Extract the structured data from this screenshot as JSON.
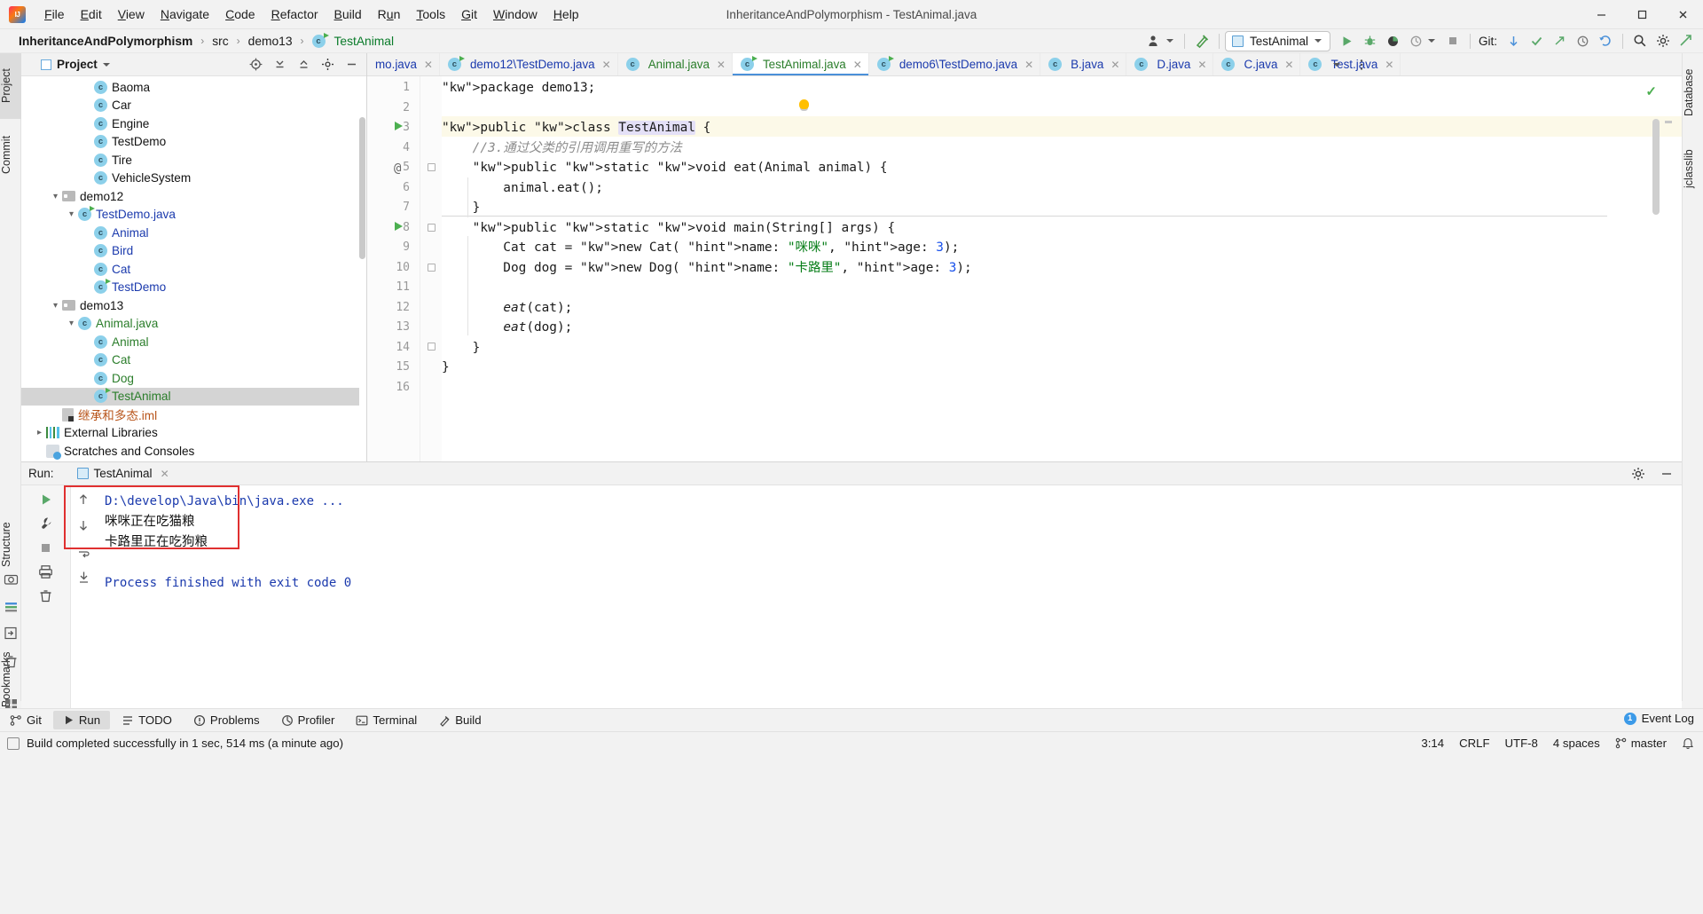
{
  "window": {
    "title": "InheritanceAndPolymorphism - TestAnimal.java",
    "minimize": "—",
    "maximize": "❐",
    "close": "✕"
  },
  "menu": [
    "File",
    "Edit",
    "View",
    "Navigate",
    "Code",
    "Refactor",
    "Build",
    "Run",
    "Tools",
    "Git",
    "Window",
    "Help"
  ],
  "breadcrumb": {
    "project": "InheritanceAndPolymorphism",
    "src": "src",
    "package": "demo13",
    "file": "TestAnimal",
    "separator": "›"
  },
  "toolbar": {
    "run_config": "TestAnimal",
    "git_label": "Git:",
    "run_tooltip": "Run",
    "debug_tooltip": "Debug",
    "coverage_tooltip": "Run with Coverage",
    "profiler_tooltip": "Profiler",
    "stop_tooltip": "Stop",
    "search_tooltip": "Search Everywhere",
    "settings_tooltip": "Settings",
    "updates_tooltip": "Updates"
  },
  "left_strip": {
    "project_tab": "Project",
    "commit_tab": "Commit",
    "structure_tab": "Structure",
    "bookmarks_tab": "Bookmarks"
  },
  "right_strip": {
    "database_tab": "Database",
    "jclasslib_tab": "jclasslib"
  },
  "project_panel": {
    "title": "Project",
    "tree": [
      {
        "label": "Baoma",
        "icon": "class-icon",
        "indent": 4,
        "arrow": "",
        "color": "dark",
        "selected": false
      },
      {
        "label": "Car",
        "icon": "class-icon",
        "indent": 4,
        "arrow": "",
        "color": "dark",
        "selected": false
      },
      {
        "label": "Engine",
        "icon": "class-icon",
        "indent": 4,
        "arrow": "",
        "color": "dark",
        "selected": false
      },
      {
        "label": "TestDemo",
        "icon": "class-icon",
        "indent": 4,
        "arrow": "",
        "color": "dark",
        "selected": false
      },
      {
        "label": "Tire",
        "icon": "class-icon",
        "indent": 4,
        "arrow": "",
        "color": "dark",
        "selected": false
      },
      {
        "label": "VehicleSystem",
        "icon": "class-icon",
        "indent": 4,
        "arrow": "",
        "color": "dark",
        "selected": false
      },
      {
        "label": "demo12",
        "icon": "folder-icon",
        "indent": 2,
        "arrow": "v",
        "color": "dark",
        "selected": false
      },
      {
        "label": "TestDemo.java",
        "icon": "class-run-icon",
        "indent": 3,
        "arrow": "v",
        "color": "blue",
        "selected": false
      },
      {
        "label": "Animal",
        "icon": "class-icon",
        "indent": 4,
        "arrow": "",
        "color": "blue",
        "selected": false
      },
      {
        "label": "Bird",
        "icon": "class-icon",
        "indent": 4,
        "arrow": "",
        "color": "blue",
        "selected": false
      },
      {
        "label": "Cat",
        "icon": "class-icon",
        "indent": 4,
        "arrow": "",
        "color": "blue",
        "selected": false
      },
      {
        "label": "TestDemo",
        "icon": "class-run-icon",
        "indent": 4,
        "arrow": "",
        "color": "blue",
        "selected": false
      },
      {
        "label": "demo13",
        "icon": "folder-icon",
        "indent": 2,
        "arrow": "v",
        "color": "dark",
        "selected": false
      },
      {
        "label": "Animal.java",
        "icon": "class-icon",
        "indent": 3,
        "arrow": "v",
        "color": "green",
        "selected": false
      },
      {
        "label": "Animal",
        "icon": "class-icon",
        "indent": 4,
        "arrow": "",
        "color": "green",
        "selected": false
      },
      {
        "label": "Cat",
        "icon": "class-icon",
        "indent": 4,
        "arrow": "",
        "color": "green",
        "selected": false
      },
      {
        "label": "Dog",
        "icon": "class-icon",
        "indent": 4,
        "arrow": "",
        "color": "green",
        "selected": false
      },
      {
        "label": "TestAnimal",
        "icon": "class-run-icon",
        "indent": 4,
        "arrow": "",
        "color": "green",
        "selected": true
      },
      {
        "label": "继承和多态.iml",
        "icon": "iml-icon",
        "indent": 2,
        "arrow": "",
        "color": "orange",
        "selected": false
      },
      {
        "label": "External Libraries",
        "icon": "library-icon",
        "indent": 1,
        "arrow": ">",
        "color": "dark",
        "selected": false
      },
      {
        "label": "Scratches and Consoles",
        "icon": "scratches-icon",
        "indent": 1,
        "arrow": "",
        "color": "dark",
        "selected": false
      }
    ]
  },
  "editor_tabs": [
    {
      "label": "mo.java",
      "icon": "class-icon",
      "color": "blue",
      "active": false,
      "truncated": true
    },
    {
      "label": "demo12\\TestDemo.java",
      "icon": "class-run-icon",
      "color": "blue",
      "active": false
    },
    {
      "label": "Animal.java",
      "icon": "class-icon",
      "color": "green",
      "active": false
    },
    {
      "label": "TestAnimal.java",
      "icon": "class-run-icon",
      "color": "green",
      "active": true
    },
    {
      "label": "demo6\\TestDemo.java",
      "icon": "class-run-icon",
      "color": "blue",
      "active": false
    },
    {
      "label": "B.java",
      "icon": "class-icon",
      "color": "blue",
      "active": false
    },
    {
      "label": "D.java",
      "icon": "class-icon",
      "color": "blue",
      "active": false
    },
    {
      "label": "C.java",
      "icon": "class-icon",
      "color": "blue",
      "active": false
    },
    {
      "label": "Test.java",
      "icon": "class-icon",
      "color": "blue",
      "active": false
    }
  ],
  "code": {
    "line_numbers": [
      "1",
      "2",
      "3",
      "4",
      "5",
      "6",
      "7",
      "8",
      "9",
      "10",
      "11",
      "12",
      "13",
      "14",
      "15",
      "16"
    ],
    "lines": [
      "package demo13;",
      "",
      "public class TestAnimal {",
      "    //3.通过父类的引用调用重写的方法",
      "    public static void eat(Animal animal) {",
      "        animal.eat();",
      "    }",
      "    public static void main(String[] args) {",
      "        Cat cat = new Cat( name: \"咪咪\", age: 3);",
      "        Dog dog = new Dog( name: \"卡路里\", age: 3);",
      "",
      "        eat(cat);",
      "        eat(dog);",
      "    }",
      "}",
      ""
    ],
    "caret_position": "3:14"
  },
  "run_panel": {
    "run_label": "Run:",
    "tab_name": "TestAnimal",
    "console": [
      {
        "text": "D:\\develop\\Java\\bin\\java.exe ...",
        "style": "blue"
      },
      {
        "text": "咪咪正在吃猫粮",
        "style": "black"
      },
      {
        "text": "卡路里正在吃狗粮",
        "style": "black"
      },
      {
        "text": "",
        "style": "black"
      },
      {
        "text": "Process finished with exit code 0",
        "style": "blue"
      }
    ],
    "side_buttons": [
      "rerun-icon",
      "settings-icon",
      "stop-icon",
      "print-icon",
      "trash-icon"
    ],
    "nav_buttons": [
      "scroll-up-icon",
      "scroll-down-icon",
      "soft-wrap-icon",
      "scroll-end-icon"
    ]
  },
  "bottom_tabs": [
    {
      "label": "Git",
      "icon": "git-icon",
      "selected": false
    },
    {
      "label": "Run",
      "icon": "run-icon",
      "selected": true
    },
    {
      "label": "TODO",
      "icon": "todo-icon",
      "selected": false
    },
    {
      "label": "Problems",
      "icon": "problems-icon",
      "selected": false
    },
    {
      "label": "Profiler",
      "icon": "profiler-icon",
      "selected": false
    },
    {
      "label": "Terminal",
      "icon": "terminal-icon",
      "selected": false
    },
    {
      "label": "Build",
      "icon": "build-icon",
      "selected": false
    }
  ],
  "event_log": {
    "label": "Event Log",
    "count": "1"
  },
  "status_bar": {
    "message": "Build completed successfully in 1 sec, 514 ms (a minute ago)",
    "caret": "3:14",
    "line_sep": "CRLF",
    "encoding": "UTF-8",
    "indent": "4 spaces",
    "branch": "master"
  },
  "colors": {
    "accent": "#4a90d9",
    "green": "#2a7d2a",
    "blue": "#1b3aad",
    "string": "#067d17",
    "keyword": "#0033b3",
    "error_box": "#e03030",
    "selection": "#d4d4d4"
  }
}
